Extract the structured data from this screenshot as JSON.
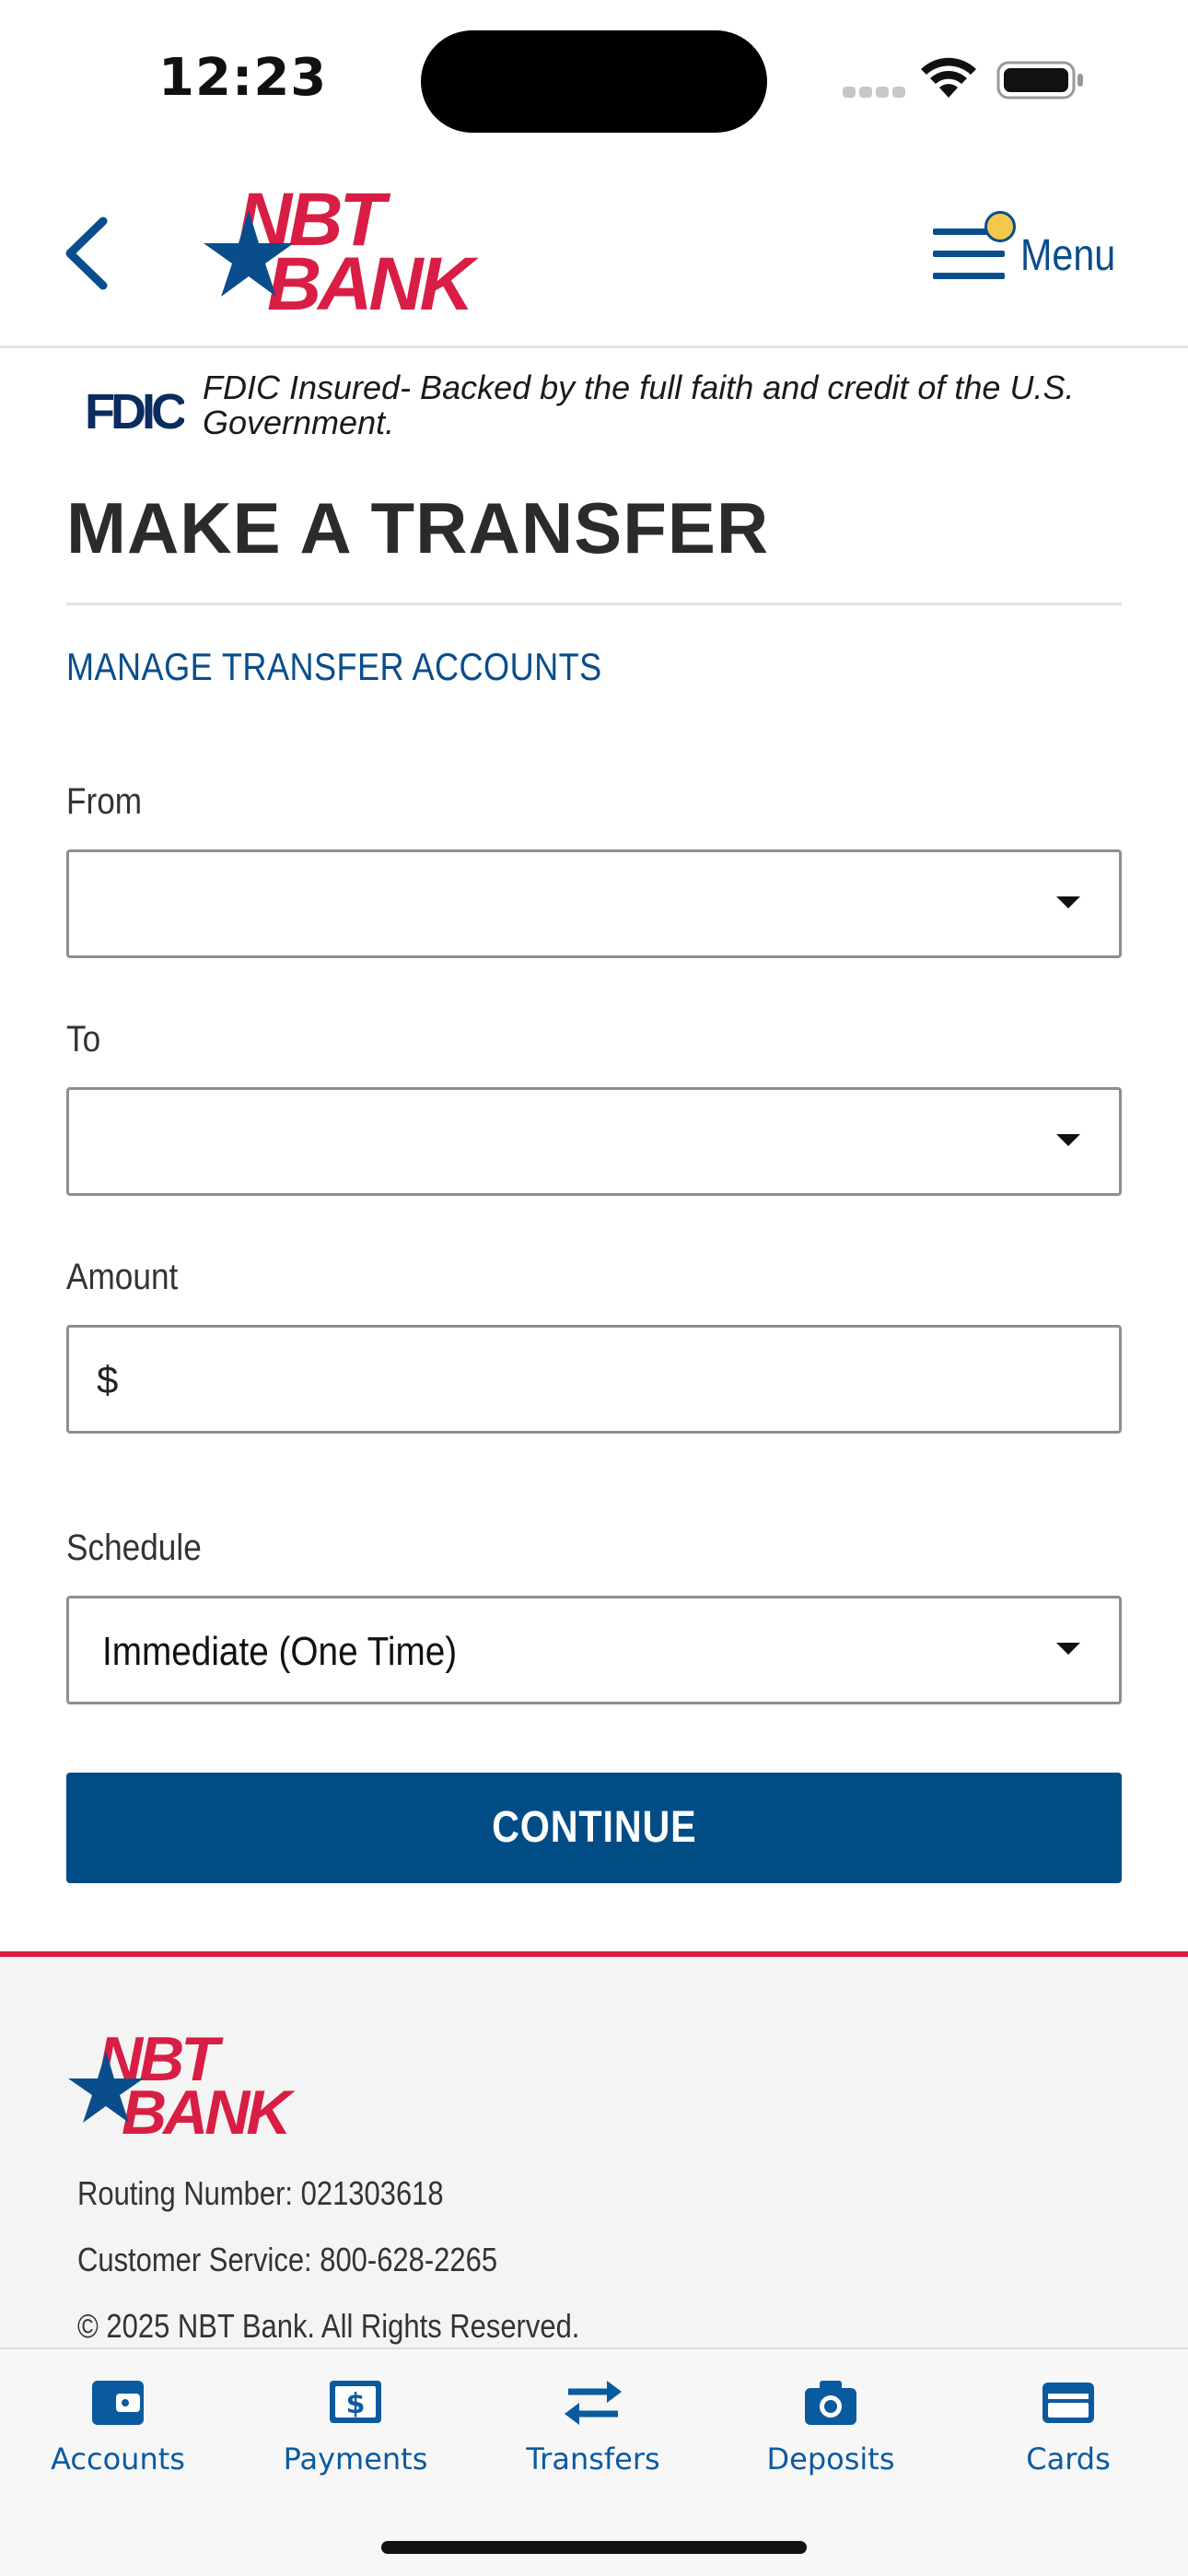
{
  "status_bar": {
    "time": "12:23"
  },
  "header": {
    "menu_label": "Menu"
  },
  "brand": {
    "logo_text": "NBT BANK",
    "red": "#d81e45",
    "blue": "#0a4d8c"
  },
  "fdic": {
    "logo_text": "FDIC",
    "text": "FDIC Insured- Backed by the full faith and credit of the U.S. Government."
  },
  "page": {
    "title": "MAKE A TRANSFER",
    "manage_link": "MANAGE TRANSFER ACCOUNTS"
  },
  "form": {
    "from": {
      "label": "From",
      "value": ""
    },
    "to": {
      "label": "To",
      "value": ""
    },
    "amount": {
      "label": "Amount",
      "prefix": "$",
      "value": ""
    },
    "schedule": {
      "label": "Schedule",
      "value": "Immediate (One Time)"
    },
    "submit_label": "CONTINUE",
    "accent": "#024c86"
  },
  "footer": {
    "routing": "Routing Number: 021303618",
    "service": "Customer Service: 800-628-2265",
    "copyright": "© 2025 NBT Bank. All Rights Reserved."
  },
  "tabs": [
    {
      "label": "Accounts",
      "icon": "wallet-icon"
    },
    {
      "label": "Payments",
      "icon": "dollar-bill-icon"
    },
    {
      "label": "Transfers",
      "icon": "transfer-arrows-icon"
    },
    {
      "label": "Deposits",
      "icon": "camera-icon"
    },
    {
      "label": "Cards",
      "icon": "credit-card-icon"
    }
  ]
}
